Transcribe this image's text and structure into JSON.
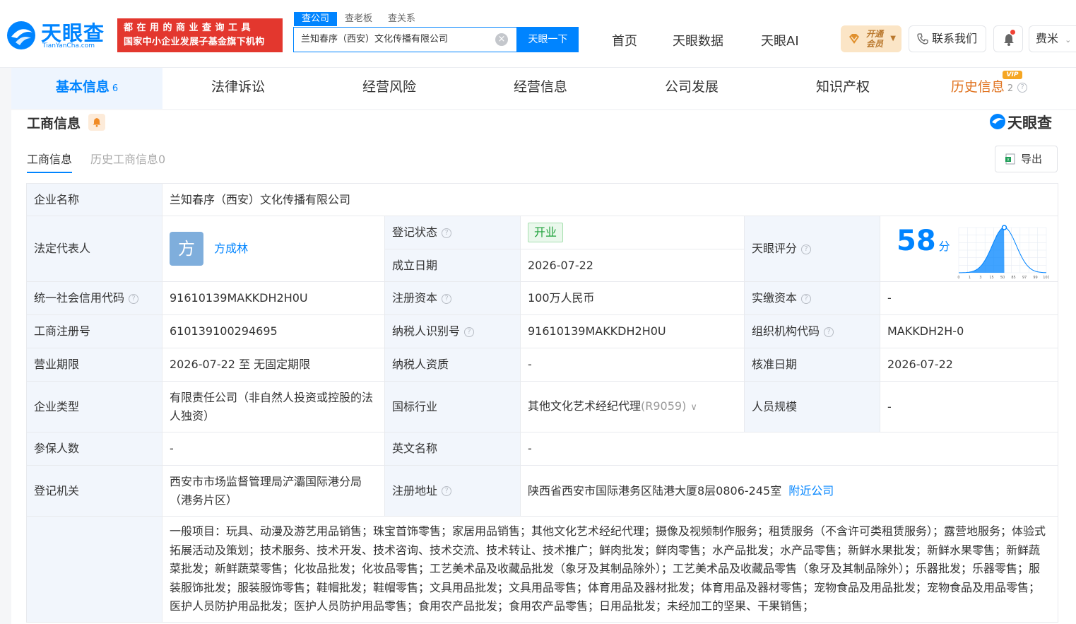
{
  "brand": {
    "name": "天眼查",
    "domain": "TianYanCha.com",
    "slogan_line1": "都在用的商业查询工具",
    "slogan_line2": "国家中小企业发展子基金旗下机构"
  },
  "search": {
    "tabs": [
      "查公司",
      "查老板",
      "查关系"
    ],
    "value": "兰知春序（西安）文化传播有限公司",
    "button": "天眼一下"
  },
  "nav": {
    "home": "首页",
    "data": "天眼数据",
    "ai": "天眼AI",
    "vip_line1": "开通",
    "vip_line2": "会员",
    "contact": "联系我们",
    "user": "费米"
  },
  "tabs": [
    {
      "label": "基本信息",
      "count": "6"
    },
    {
      "label": "法律诉讼"
    },
    {
      "label": "经营风险"
    },
    {
      "label": "经营信息"
    },
    {
      "label": "公司发展"
    },
    {
      "label": "知识产权"
    },
    {
      "label": "历史信息",
      "count": "2"
    }
  ],
  "vip_tag": "VIP",
  "section": {
    "title": "工商信息",
    "brand": "天眼查",
    "subtab_active": "工商信息",
    "subtab_history": "历史工商信息0",
    "export": "导出"
  },
  "info": {
    "company_name_label": "企业名称",
    "company_name": "兰知春序（西安）文化传播有限公司",
    "legal_rep_label": "法定代表人",
    "legal_rep_avatar": "方",
    "legal_rep": "方成林",
    "reg_status_label": "登记状态",
    "reg_status": "开业",
    "founded_label": "成立日期",
    "founded": "2026-07-22",
    "score_label": "天眼评分",
    "score": "58",
    "score_unit": "分",
    "credit_code_label": "统一社会信用代码",
    "credit_code": "91610139MAKKDH2H0U",
    "reg_capital_label": "注册资本",
    "reg_capital": "100万人民币",
    "paid_capital_label": "实缴资本",
    "paid_capital": "-",
    "reg_no_label": "工商注册号",
    "reg_no": "610139100294695",
    "taxpayer_id_label": "纳税人识别号",
    "taxpayer_id": "91610139MAKKDH2H0U",
    "org_code_label": "组织机构代码",
    "org_code": "MAKKDH2H-0",
    "term_label": "营业期限",
    "term": "2026-07-22 至 无固定期限",
    "taxpayer_qual_label": "纳税人资质",
    "taxpayer_qual": "-",
    "approved_label": "核准日期",
    "approved": "2026-07-22",
    "type_label": "企业类型",
    "type": "有限责任公司（非自然人投资或控股的法人独资）",
    "industry_label": "国标行业",
    "industry": "其他文化艺术经纪代理",
    "industry_code": "(R9059)",
    "staff_label": "人员规模",
    "staff": "-",
    "insured_label": "参保人数",
    "insured": "-",
    "english_label": "英文名称",
    "english": "-",
    "authority_label": "登记机关",
    "authority": "西安市市场监督管理局浐灞国际港分局（港务片区）",
    "address_label": "注册地址",
    "address": "陕西省西安市国际港务区陆港大厦8层0806-245室",
    "nearby": "附近公司",
    "scope": "一般项目：玩具、动漫及游艺用品销售；珠宝首饰零售；家居用品销售；其他文化艺术经纪代理；摄像及视频制作服务；租赁服务（不含许可类租赁服务）；露营地服务；体验式拓展活动及策划；技术服务、技术开发、技术咨询、技术交流、技术转让、技术推广；鲜肉批发；鲜肉零售；水产品批发；水产品零售；新鲜水果批发；新鲜水果零售；新鲜蔬菜批发；新鲜蔬菜零售；化妆品批发；化妆品零售；工艺美术品及收藏品批发（象牙及其制品除外）；工艺美术品及收藏品零售（象牙及其制品除外）；乐器批发；乐器零售；服装服饰批发；服装服饰零售；鞋帽批发；鞋帽零售；文具用品批发；文具用品零售；体育用品及器材批发；体育用品及器材零售；宠物食品及用品批发；宠物食品及用品零售；医护人员防护用品批发；医护人员防护用品零售；食用农产品批发；食用农产品零售；日用品批发；未经加工的坚果、干果销售；"
  },
  "score_chart": {
    "ticks": [
      "0",
      "1",
      "3",
      "15",
      "50",
      "85",
      "97",
      "99",
      "100"
    ],
    "peak_color": "#0084ff"
  }
}
